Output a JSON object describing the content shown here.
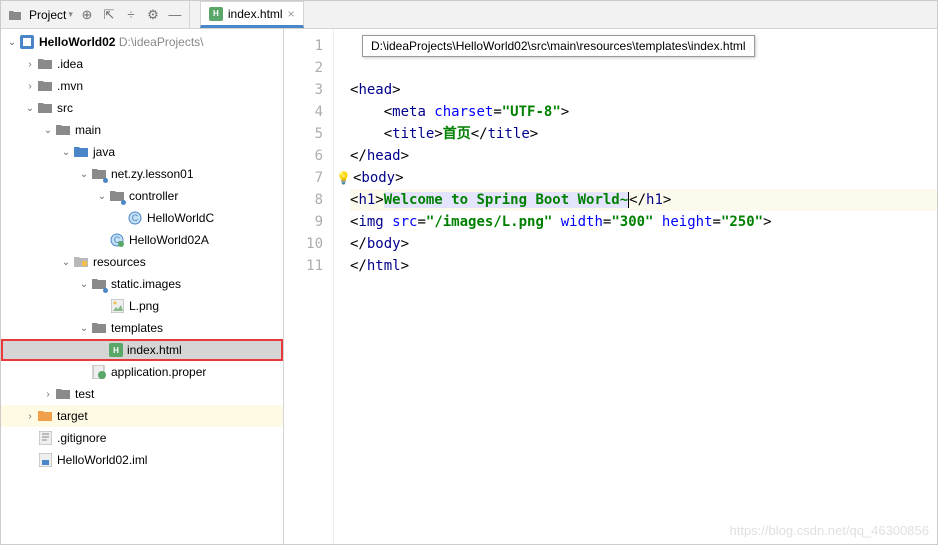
{
  "toolbar": {
    "project_label": "Project"
  },
  "tab": {
    "name": "index.html"
  },
  "tooltip": "D:\\ideaProjects\\HelloWorld02\\src\\main\\resources\\templates\\index.html",
  "tree": {
    "root": "HelloWorld02",
    "root_path": "D:\\ideaProjects\\",
    "idea": ".idea",
    "mvn": ".mvn",
    "src": "src",
    "main": "main",
    "java": "java",
    "pkg": "net.zy.lesson01",
    "controller": "controller",
    "cls1": "HelloWorldC",
    "cls2": "HelloWorld02A",
    "resources": "resources",
    "static": "static.images",
    "lpng": "L.png",
    "templates": "templates",
    "index": "index.html",
    "appprops": "application.proper",
    "test": "test",
    "target": "target",
    "gitignore": ".gitignore",
    "iml": "HelloWorld02.iml"
  },
  "lines": [
    "1",
    "2",
    "3",
    "4",
    "5",
    "6",
    "7",
    "8",
    "9",
    "10",
    "11"
  ],
  "code": {
    "l3o": "<",
    "l3n": "head",
    "l3c": ">",
    "l4o": "<",
    "l4n": "meta",
    "l4a": " charset",
    "l4e": "=",
    "l4v": "\"UTF-8\"",
    "l4c": ">",
    "l5o": "<",
    "l5n": "title",
    "l5c": ">",
    "l5t": "首页",
    "l5co": "</",
    "l5cn": "title",
    "l5cc": ">",
    "l6o": "</",
    "l6n": "head",
    "l6c": ">",
    "l7o": "<",
    "l7n": "body",
    "l7c": ">",
    "l8o": "<",
    "l8n": "h1",
    "l8c": ">",
    "l8t": "Welcome to Spring Boot World~",
    "l8co": "</",
    "l8cn": "h1",
    "l8cc": ">",
    "l9o": "<",
    "l9n": "img",
    "l9a1": " src",
    "l9e": "=",
    "l9v1": "\"/images/L.png\"",
    "l9a2": " width",
    "l9v2": "\"300\"",
    "l9a3": " height",
    "l9v3": "\"250\"",
    "l9c": ">",
    "l10o": "</",
    "l10n": "body",
    "l10c": ">",
    "l11o": "</",
    "l11n": "html",
    "l11c": ">"
  },
  "watermark": "https://blog.csdn.net/qq_46300856"
}
